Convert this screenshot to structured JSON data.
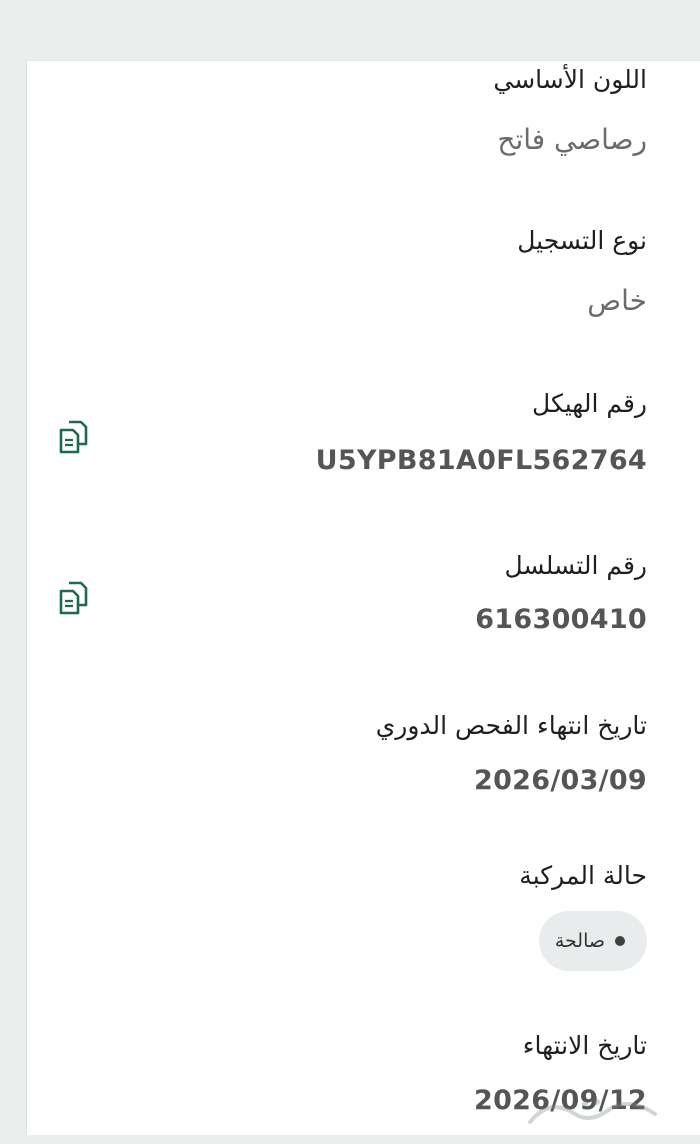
{
  "fields": [
    {
      "label": "اللون الأساسي",
      "value": "رصاصي فاتح"
    },
    {
      "label": "نوع التسجيل",
      "value": "خاص"
    },
    {
      "label": "رقم الهيكل",
      "value": "U5YPB81A0FL562764",
      "copy_icon": "copy-icon"
    },
    {
      "label": "رقم التسلسل",
      "value": "616300410",
      "copy_icon": "copy-icon"
    },
    {
      "label": "تاريخ انتهاء الفحص الدوري",
      "value": "2026/03/09"
    },
    {
      "label": "حالة المركبة",
      "status_chip": "صالحة"
    },
    {
      "label": "تاريخ الانتهاء",
      "value": "2026/09/12"
    }
  ],
  "colors": {
    "copy_icon": "#1e6b4a",
    "page_bg": "#eceeee",
    "card_bg": "#ffffff",
    "chip_bg": "#e9ecec"
  }
}
